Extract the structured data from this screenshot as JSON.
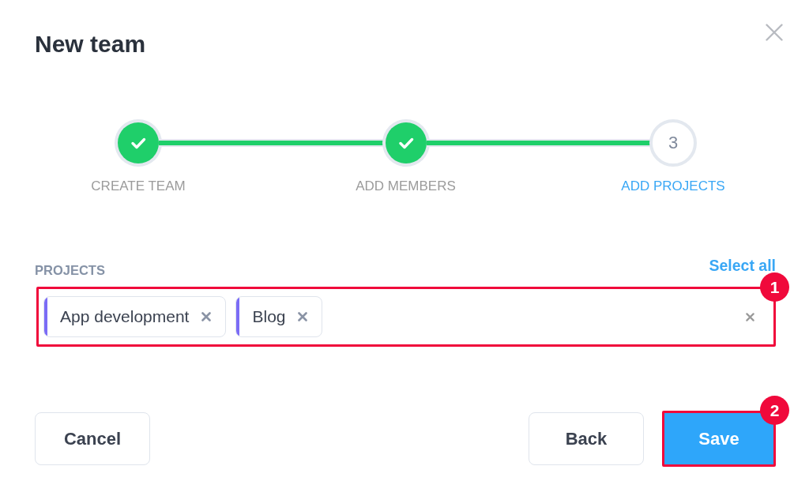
{
  "dialog": {
    "title": "New team"
  },
  "steps": [
    {
      "label": "CREATE TEAM",
      "done": true,
      "selected": false
    },
    {
      "label": "ADD MEMBERS",
      "done": true,
      "selected": false
    },
    {
      "label": "ADD PROJECTS",
      "number": "3",
      "done": false,
      "selected": true
    }
  ],
  "projects_field": {
    "label": "PROJECTS",
    "select_all": "Select all",
    "tags": [
      {
        "label": "App development",
        "color": "#7b6cf6"
      },
      {
        "label": "Blog",
        "color": "#7b6cf6"
      }
    ],
    "callout": "1"
  },
  "footer": {
    "left": [
      {
        "label": "Cancel",
        "kind": "secondary"
      }
    ],
    "right": [
      {
        "label": "Back",
        "kind": "secondary"
      },
      {
        "label": "Save",
        "kind": "primary",
        "callout": "2"
      }
    ]
  }
}
